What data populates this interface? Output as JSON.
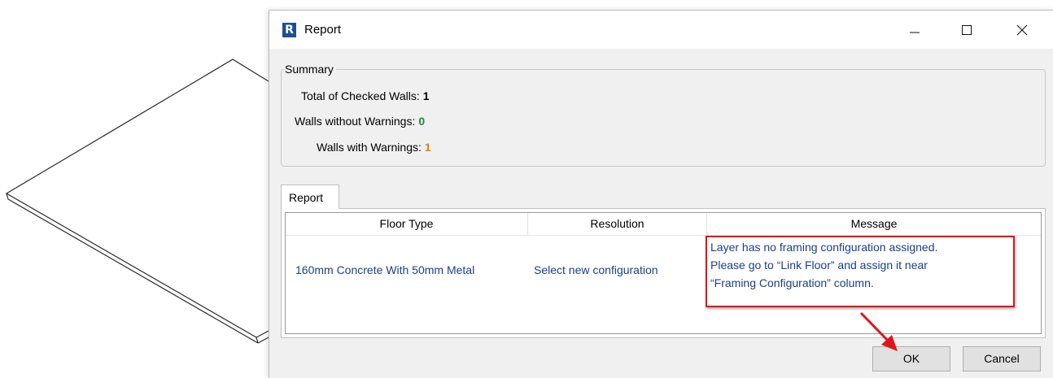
{
  "window": {
    "title": "Report",
    "icon_letter": "R"
  },
  "summary": {
    "legend": "Summary",
    "rows": [
      {
        "label": "Total of Checked Walls:",
        "value": "1",
        "color": "#000000"
      },
      {
        "label": "Walls without Warnings:",
        "value": "0",
        "color": "#1f8a3a"
      },
      {
        "label": "Walls with Warnings:",
        "value": "1",
        "color": "#e57c10"
      }
    ]
  },
  "tab": {
    "label": "Report"
  },
  "table": {
    "columns": [
      "Floor Type",
      "Resolution",
      "Message"
    ],
    "rows": [
      {
        "floor_type": "160mm Concrete With 50mm Metal",
        "resolution": "Select new configuration",
        "message_lines": [
          "Layer has no framing configuration assigned.",
          "Please go to “Link Floor” and assign it near",
          "“Framing Configuration” column."
        ]
      }
    ]
  },
  "buttons": {
    "ok": "OK",
    "cancel": "Cancel"
  },
  "colors": {
    "highlight": "#e0141b",
    "cell_text": "#1a3e8c",
    "app_icon": "#1d4f91"
  }
}
